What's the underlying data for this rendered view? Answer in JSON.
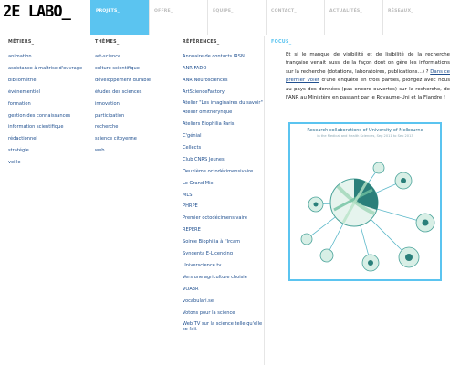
{
  "logo": "2E LABO_",
  "nav": [
    "PROJETS_",
    "OFFRE_",
    "ÉQUIPE_",
    "CONTACT_",
    "ACTUALITÉS_",
    "RÉSEAUX_"
  ],
  "metiers": {
    "title": "MÉTIERS_",
    "items": [
      "animation",
      "assistance à maîtrise d'ouvrage",
      "bibliométrie",
      "événementiel",
      "formation",
      "gestion des connaissances",
      "information scientifique",
      "rédactionnel",
      "stratégie",
      "veille"
    ]
  },
  "themes": {
    "title": "THÈMES_",
    "items": [
      "art-science",
      "culture scientifique",
      "développement durable",
      "études des sciences",
      "innovation",
      "participation",
      "recherche",
      "science citoyenne",
      "web"
    ]
  },
  "references": {
    "title": "RÉFÉRENCES_",
    "items": [
      "Annuaire de contacts IRSN",
      "ANR FADO",
      "ANR Neurosciences",
      "ArtScienceFactory",
      "Atelier \"Les imaginaires du savoir\"",
      "Atelier ornithorynque",
      "Ateliers Biophilia Paris",
      "C'génial",
      "Cellects",
      "Club CNRS Jeunes",
      "Deuxième octodécimensivaire",
      "Le Grand Mix",
      "MLS",
      "PHRPE",
      "Premier octodécimensivaire",
      "REPERE",
      "Soirée Biophilia à l'Ircam",
      "Syngenta E-Licencing",
      "Universcience.tv",
      "Vers une agriculture choisie",
      "VOA3R",
      "vocabulari.se",
      "Votons pour la science",
      "Web TV sur la science telle qu'elle se fait"
    ]
  },
  "focus": {
    "title": "FOCUS_",
    "text_before": "Et si le manque de visibilité et de lisibilité de la recherche française venait aussi de la façon dont on gère les informations sur la recherche (dotations, laboratoires, publications…) ? ",
    "link_text": "Dans ce premier volet",
    "text_after": " d'une enquête en trois parties, plongez avec nous au pays des données (pas encore ouvertes) sur la recherche, de l'ANR au Ministère en passant par le Royaume-Uni et la Flandre !",
    "figure_title": "Research collaborations of University of Melbourne",
    "figure_subtitle": "in the Medical and Health Sciences, Sep 2011 to Sep 2013"
  },
  "colors": {
    "accent": "#5bc4f0",
    "link": "#1f4f8f",
    "chord_dark": "#2a7f7a",
    "chord_light": "#9fd6b6"
  }
}
